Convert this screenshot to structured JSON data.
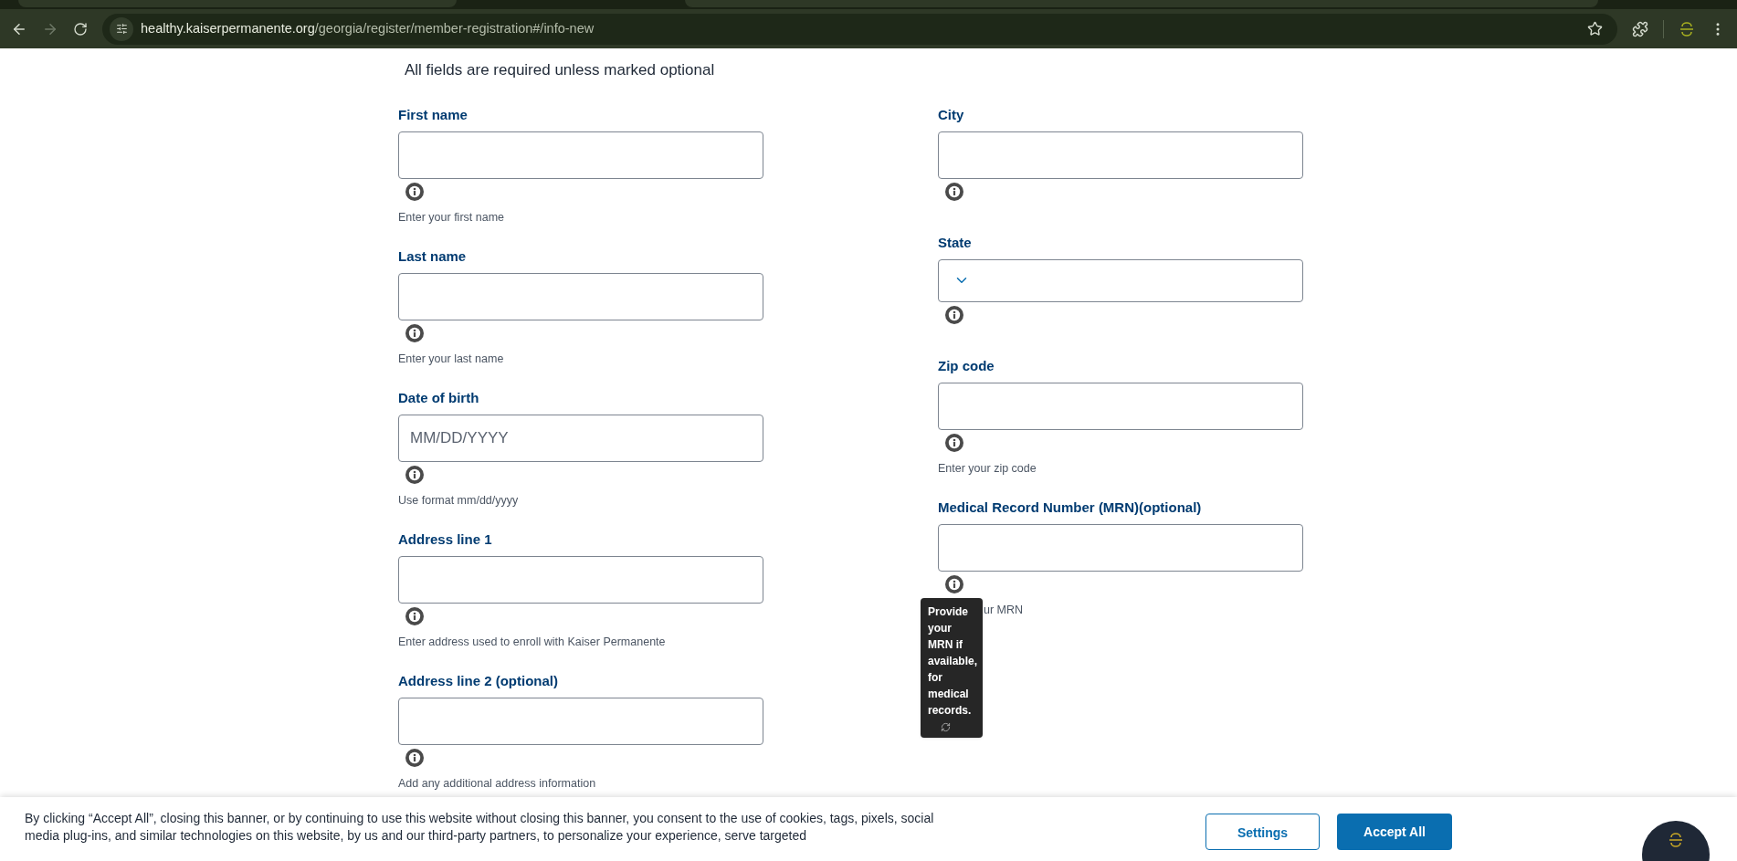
{
  "browser": {
    "url_host": "healthy.kaiserpermanente.org",
    "url_path": "/georgia/register/member-registration#/info-new"
  },
  "form": {
    "note": "All fields are required unless marked optional",
    "columns": [
      {
        "fields": [
          {
            "kind": "text",
            "label": "First name",
            "hint": "Enter your first name"
          },
          {
            "kind": "text",
            "label": "Last name",
            "hint": "Enter your last name"
          },
          {
            "kind": "text",
            "label": "Date of birth",
            "placeholder": "MM/DD/YYYY",
            "hint": "Use format mm/dd/yyyy"
          },
          {
            "kind": "text",
            "label": "Address line 1",
            "hint": "Enter address used to enroll with Kaiser Permanente"
          },
          {
            "kind": "text",
            "label": "Address line 2 (optional)",
            "hint": "Add any additional address information"
          }
        ]
      },
      {
        "fields": [
          {
            "kind": "text",
            "label": "City"
          },
          {
            "kind": "select",
            "label": "State"
          },
          {
            "kind": "text",
            "label": "Zip code",
            "hint": "Enter your zip code"
          },
          {
            "kind": "text",
            "label": "Medical Record Number (MRN)(optional)",
            "hint": "ur MRN",
            "tooltip": "Provide your MRN if available, for medical records."
          }
        ]
      }
    ]
  },
  "cookie_banner": {
    "text": "By clicking “Accept All”, closing this banner, or by continuing to use this website without closing this banner, you consent to the use of cookies, tags, pixels, social media plug-ins, and similar technologies on this website, by us and our third-party partners, to personalize your experience, serve targeted",
    "buttons": [
      {
        "label": "Settings",
        "kind": "secondary"
      },
      {
        "label": "Accept All",
        "kind": "primary"
      }
    ]
  }
}
